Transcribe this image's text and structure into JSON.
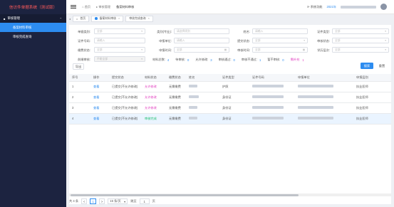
{
  "app": {
    "title": "信访件单据系统（测试版）"
  },
  "sidebar": {
    "group_label": "审核管理",
    "items": [
      {
        "label": "备案材料审核"
      },
      {
        "label": "审核完成查询"
      }
    ]
  },
  "header": {
    "breadcrumb": [
      "首页",
      "审核管理",
      "备案材料审核"
    ],
    "right_items": [
      "系统功能",
      "2021年"
    ]
  },
  "tabs": [
    {
      "label": "首页"
    },
    {
      "label": "备案材料审核"
    },
    {
      "label": "审核完成查询"
    }
  ],
  "filters": {
    "row1": [
      {
        "label": "单据类别:",
        "placeholder": "全部"
      },
      {
        "label": "类别(专业):",
        "placeholder": "请选择类别"
      },
      {
        "label": "姓名:",
        "placeholder": "请输入"
      },
      {
        "label": "证件类型:",
        "placeholder": "全部"
      }
    ],
    "row2": [
      {
        "label": "证件号码:",
        "placeholder": "请输入"
      },
      {
        "label": "申报单位:",
        "placeholder": "请输入"
      },
      {
        "label": "提交状态:",
        "placeholder": "全部"
      },
      {
        "label": "审核状态:",
        "placeholder": "全部"
      }
    ],
    "row3": [
      {
        "label": "缴费状态:",
        "placeholder": "全部"
      },
      {
        "label": "申报时间:",
        "placeholder": "全部"
      },
      {
        "label": "审核时间:",
        "placeholder": "全部"
      },
      {
        "label": "学历层次:",
        "placeholder": "全部"
      }
    ],
    "row4": [
      {
        "label": "前端审核:",
        "placeholder": "不能全部"
      }
    ]
  },
  "stats": [
    {
      "label": "材料总数:",
      "value": "4"
    },
    {
      "label": "待审核:",
      "value": "0"
    },
    {
      "label": "允许修改:",
      "value": "3"
    },
    {
      "label": "审核通过:",
      "value": "0"
    },
    {
      "label": "审核不通过:",
      "value": "1"
    },
    {
      "label": "暂不审核:",
      "value": "0"
    },
    {
      "label": "需补充:",
      "value": "1"
    }
  ],
  "buttons": {
    "export": "导出",
    "search": "搜索",
    "reset": "重置"
  },
  "table": {
    "columns": [
      "序号",
      "操作",
      "提交状态",
      "材料状态",
      "缴费状态",
      "姓名",
      "证件类型",
      "证件号码",
      "申报单位",
      "申报层别"
    ],
    "rows": [
      {
        "no": "1",
        "op": "查看",
        "submit": "已提交(不允许修改)",
        "material": "允许修改",
        "pay": "无需缴费",
        "idtype": "护照",
        "level": "执业医师",
        "material_color": "pink"
      },
      {
        "no": "2",
        "op": "查看",
        "submit": "已提交(不允许修改)",
        "material": "允许修改",
        "pay": "无需缴费",
        "idtype": "身份证",
        "level": "执业医师",
        "material_color": "pink"
      },
      {
        "no": "3",
        "op": "查看",
        "submit": "已提交(不允许修改)",
        "material": "允许修改",
        "pay": "无需缴费",
        "idtype": "身份证",
        "level": "执业医师",
        "material_color": "pink"
      },
      {
        "no": "4",
        "op": "查看",
        "submit": "已提交(不允许修改)",
        "material": "审核完成",
        "pay": "无需缴费",
        "idtype": "身份证",
        "level": "执业医师",
        "material_color": "green"
      }
    ]
  },
  "pager": {
    "total": "共 4 条",
    "prev": "<",
    "page": "1",
    "next": ">",
    "page_size": "15 条/页",
    "goto_label": "跳至",
    "goto_value": "1",
    "page_unit": "页"
  },
  "colors": {
    "accent": "#2d8cf0",
    "sidebar_bg": "#1c2340",
    "logo_text": "#ff5a5a"
  }
}
